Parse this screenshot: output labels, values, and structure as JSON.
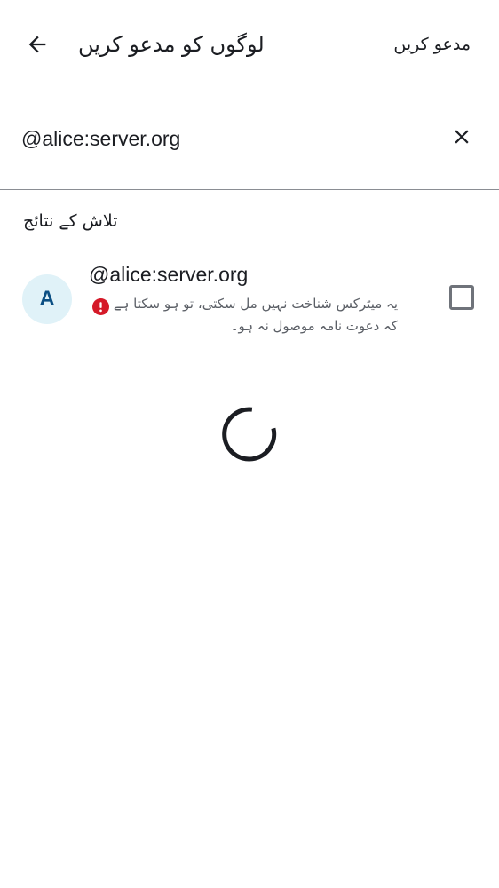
{
  "header": {
    "title": "لوگوں کو مدعو کریں",
    "invite_label": "مدعو کریں",
    "back_icon": "arrow-back-icon"
  },
  "search": {
    "value": "@alice:server.org",
    "clear_icon": "close-icon"
  },
  "results": {
    "section_title": "تلاش کے نتائج",
    "items": [
      {
        "avatar_letter": "A",
        "name": "@alice:server.org",
        "warning": "یہ میٹرکس شناخت نہیں مل سکتی، تو ہو سکتا ہے کہ دعوت نامہ موصول نہ ہو۔",
        "warning_icon": "error-icon",
        "checked": false
      }
    ]
  },
  "colors": {
    "avatar_bg": "#e0f2f8",
    "avatar_text": "#0b4f83",
    "error": "#d51928",
    "text_primary": "#1b1d22",
    "text_secondary": "#5b5f66"
  },
  "loading": true
}
